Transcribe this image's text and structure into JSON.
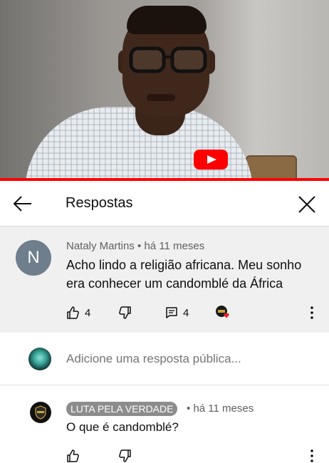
{
  "video": {
    "progress_percent": 100,
    "logo_icon": "youtube-play-icon"
  },
  "header": {
    "title": "Respostas",
    "back_icon": "arrow-left-icon",
    "close_icon": "close-icon"
  },
  "parent_comment": {
    "avatar_letter": "N",
    "author": "Nataly Martins",
    "separator": "•",
    "time": "há 11 meses",
    "text": "Acho lindo a religião africana. Meu sonho era conhecer um candomblé da África",
    "likes": "4",
    "replies": "4"
  },
  "add_reply": {
    "placeholder": "Adicione uma resposta pública..."
  },
  "reply": {
    "author": "LUTA PELA VERDADE",
    "separator": "•",
    "time": "há 11 meses",
    "text": "O que é candomblé?"
  },
  "colors": {
    "accent": "#ff0000",
    "comment_bg": "#f0f0f0",
    "meta_text": "#606060",
    "avatar_n": "#6f7e8c",
    "badge_bg": "#8c8c8c"
  }
}
